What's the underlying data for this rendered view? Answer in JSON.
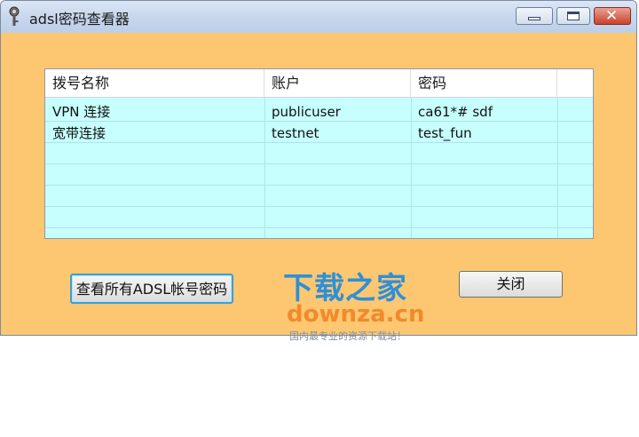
{
  "window": {
    "title": "adsl密码查看器"
  },
  "titlebar": {
    "minimize_icon": "minimize-icon",
    "maximize_icon": "maximize-icon",
    "close_glyph": "✕"
  },
  "table": {
    "columns": [
      "拨号名称",
      "账户",
      "密码"
    ],
    "rows": [
      [
        "VPN 连接",
        "publicuser",
        "ca61*# sdf"
      ],
      [
        "宽带连接",
        "testnet",
        "test_fun"
      ]
    ]
  },
  "buttons": {
    "view_all": "查看所有ADSL帐号密码",
    "close": "关闭"
  },
  "watermark": {
    "cn": "下载之家",
    "en": "downza.cn",
    "tagline": "国内最专业的资源下载站！"
  },
  "colors": {
    "window_bg": "#fcc770",
    "list_bg": "#c7ffff",
    "watermark_blue": "#2f8fd8",
    "watermark_orange": "#f18a2c"
  }
}
